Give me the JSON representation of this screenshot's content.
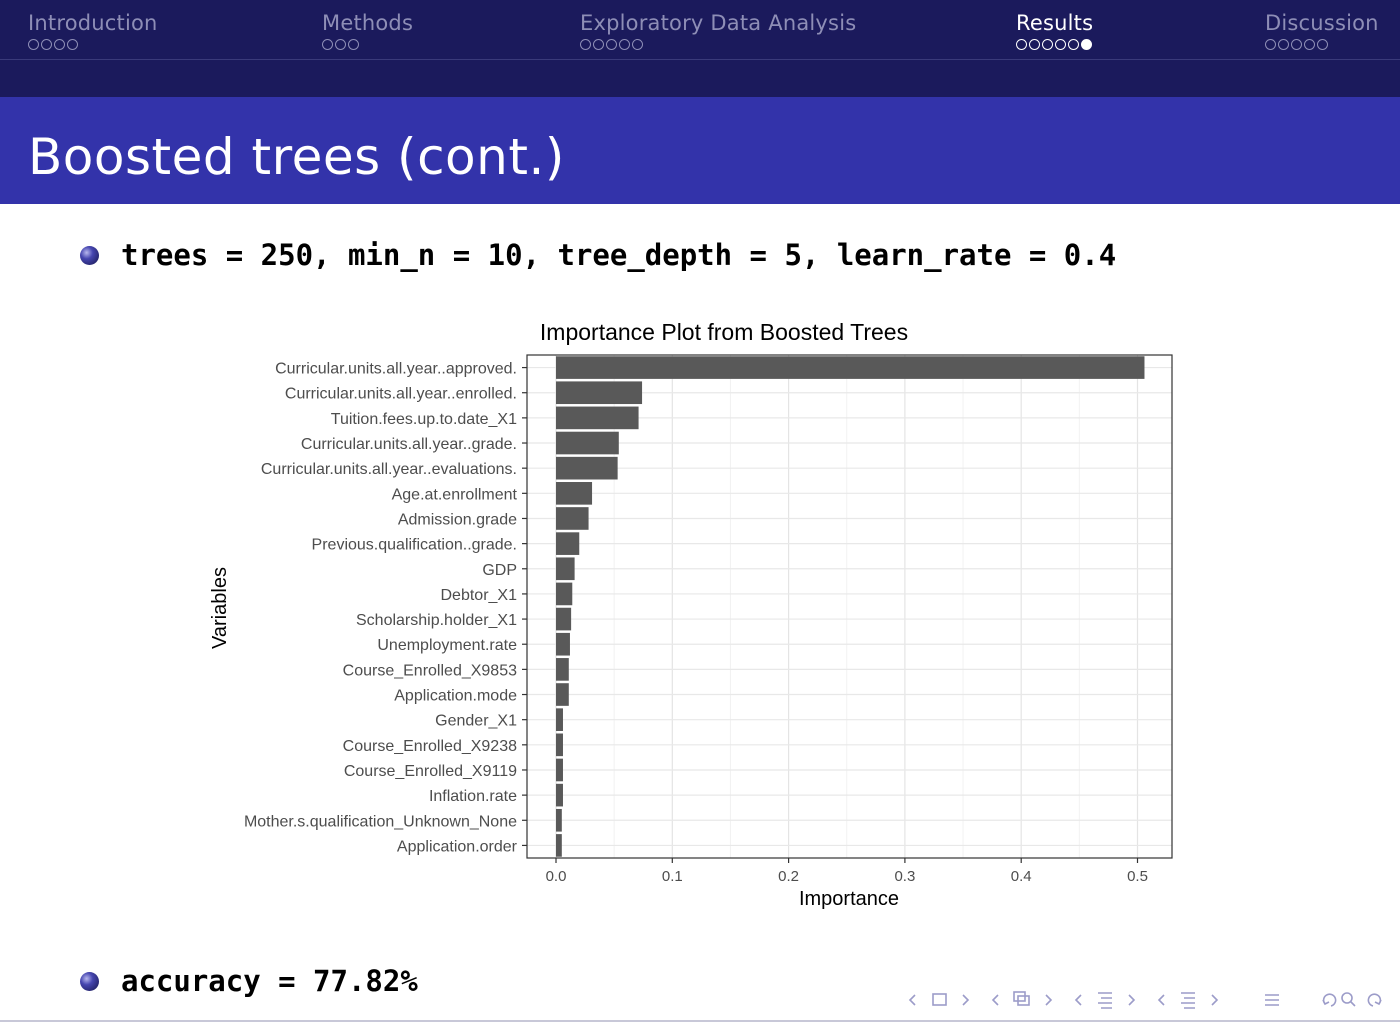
{
  "nav": {
    "sections": [
      {
        "label": "Introduction",
        "dots": 4,
        "current": -1
      },
      {
        "label": "Methods",
        "dots": 3,
        "current": -1
      },
      {
        "label": "Exploratory Data Analysis",
        "dots": 5,
        "current": -1
      },
      {
        "label": "Results",
        "dots": 6,
        "current": 5
      },
      {
        "label": "Discussion",
        "dots": 5,
        "current": -1
      }
    ],
    "active_section": "Results"
  },
  "frame": {
    "title": "Boosted trees (cont.)"
  },
  "bullets": {
    "params": "trees = 250, min_n = 10, tree_depth = 5, learn_rate = 0.4",
    "accuracy": "accuracy = 77.82%"
  },
  "colors": {
    "header_bg": "#1b1a5c",
    "title_bg": "#3333aa",
    "bar_fill": "#595959",
    "nav_inactive": "#8e8eb6"
  },
  "beamer_nav_icons": [
    "arrow-left-icon",
    "frame-icon",
    "arrow-right-icon",
    "arrow-left-icon",
    "subsection-icon",
    "arrow-right-icon",
    "arrow-left-icon",
    "section-icon",
    "arrow-right-icon",
    "arrow-left-icon",
    "document-icon",
    "arrow-right-icon",
    "align-icon",
    "undo-icon",
    "search-icon",
    "redo-icon"
  ],
  "chart_data": {
    "type": "bar",
    "orientation": "horizontal",
    "title": "Importance Plot from Boosted Trees",
    "xlabel": "Importance",
    "ylabel": "Variables",
    "xlim": [
      0,
      0.5
    ],
    "xticks": [
      "0.0",
      "0.1",
      "0.2",
      "0.3",
      "0.4",
      "0.5"
    ],
    "grid": true,
    "categories": [
      "Curricular.units.all.year..approved.",
      "Curricular.units.all.year..enrolled.",
      "Tuition.fees.up.to.date_X1",
      "Curricular.units.all.year..grade.",
      "Curricular.units.all.year..evaluations.",
      "Age.at.enrollment",
      "Admission.grade",
      "Previous.qualification..grade.",
      "GDP",
      "Debtor_X1",
      "Scholarship.holder_X1",
      "Unemployment.rate",
      "Course_Enrolled_X9853",
      "Application.mode",
      "Gender_X1",
      "Course_Enrolled_X9238",
      "Course_Enrolled_X9119",
      "Inflation.rate",
      "Mother.s.qualification_Unknown_None",
      "Application.order"
    ],
    "values": [
      0.506,
      0.074,
      0.071,
      0.054,
      0.053,
      0.031,
      0.028,
      0.02,
      0.016,
      0.014,
      0.013,
      0.012,
      0.011,
      0.011,
      0.006,
      0.006,
      0.006,
      0.006,
      0.005,
      0.005
    ]
  }
}
